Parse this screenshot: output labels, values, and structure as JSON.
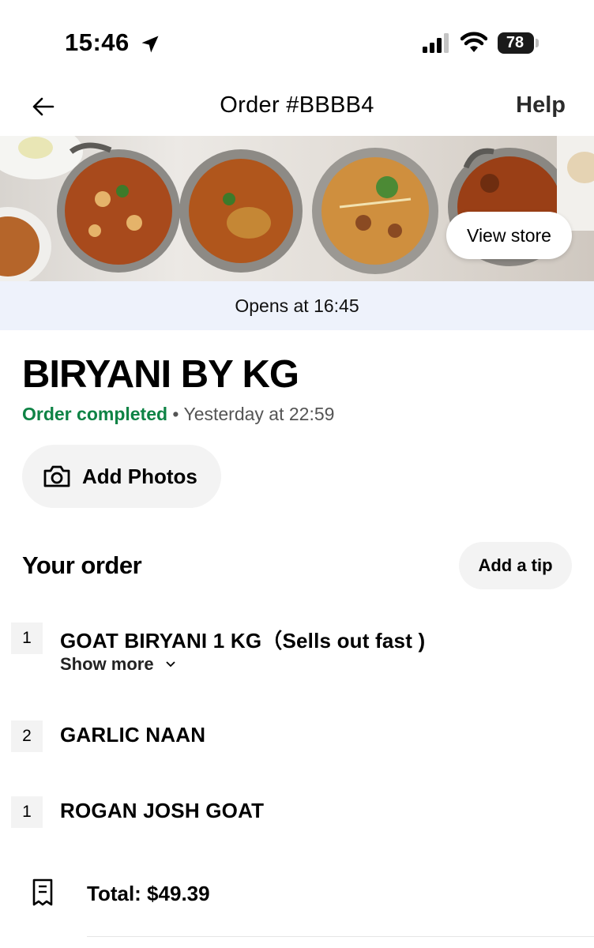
{
  "status_bar": {
    "time": "15:46",
    "battery": "78"
  },
  "header": {
    "title": "Order #BBBB4",
    "help_label": "Help"
  },
  "hero": {
    "view_store_label": "View store"
  },
  "banner": {
    "opens_text": "Opens at 16:45"
  },
  "store": {
    "name": "BIRYANI BY KG",
    "status": "Order completed",
    "separator": " • ",
    "timestamp": "Yesterday at 22:59"
  },
  "actions": {
    "add_photos_label": "Add Photos",
    "add_tip_label": "Add a tip"
  },
  "order": {
    "heading": "Your order",
    "items": [
      {
        "qty": "1",
        "name": "GOAT BIRYANI 1 KG（Sells out fast )",
        "show_more": "Show more"
      },
      {
        "qty": "2",
        "name": "GARLIC NAAN"
      },
      {
        "qty": "1",
        "name": "ROGAN JOSH GOAT"
      }
    ],
    "total": "Total: $49.39"
  },
  "colors": {
    "status_green": "#0e8345",
    "banner_bg": "#eef2fb",
    "pill_bg": "#f3f3f3"
  },
  "icons": {
    "back": "arrow-left-icon",
    "location": "location-arrow-icon",
    "signal": "cellular-signal-icon",
    "wifi": "wifi-icon",
    "camera": "camera-icon",
    "chevron": "chevron-down-icon",
    "receipt": "receipt-icon"
  }
}
